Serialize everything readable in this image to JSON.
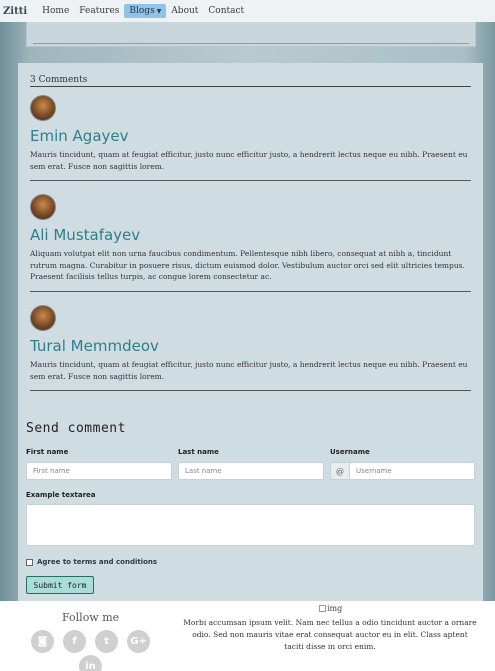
{
  "navbar": {
    "brand": "Zitti",
    "links": [
      "Home",
      "Features",
      "Blogs",
      "About",
      "Contact"
    ],
    "active": "Blogs"
  },
  "comments": {
    "count_label": "3 Comments",
    "items": [
      {
        "name": "Emin Agayev",
        "text": "Mauris tincidunt, quam at feugiat efficitur, justo nunc efficitur justo, a hendrerit lectus neque eu nibh. Praesent eu sem erat. Fusce non sagittis lorem."
      },
      {
        "name": "Ali Mustafayev",
        "text": "Aliquam volutpat elit non urna faucibus condimentum. Pellentesque nibh libero, consequat at nibh a, tincidunt rutrum magna. Curabitur in posuere risus, dictum euismod dolor. Vestibulum auctor orci sed elit ultricies tempus. Praesent facilisis tellus turpis, ac congue lorem consectetur ac."
      },
      {
        "name": "Tural Memmdeov",
        "text": "Mauris tincidunt, quam at feugiat efficitur, justo nunc efficitur justo, a hendrerit lectus neque eu nibh. Praesent eu sem erat. Fusce non sagittis lorem."
      }
    ]
  },
  "form": {
    "title": "Send comment",
    "first_name_label": "First name",
    "first_name_placeholder": "First name",
    "last_name_label": "Last name",
    "last_name_placeholder": "Last name",
    "username_label": "Username",
    "username_prefix": "@",
    "username_placeholder": "Username",
    "textarea_label": "Example textarea",
    "terms_label": "Agree to terms and conditions",
    "submit_label": "Submit form"
  },
  "footer": {
    "follow_label": "Follow me",
    "social_icons": [
      "instagram-icon",
      "facebook-icon",
      "twitter-icon",
      "google-plus-icon",
      "linkedin-icon"
    ],
    "social_glyphs": [
      "◙",
      "f",
      "t",
      "G+",
      "in"
    ],
    "image_alt": "img",
    "text": "Morbi accumsan ipsum velit. Nam nec tellus a odio tincidunt auctor a ornare odio. Sed non mauris vitae erat consequat auctor eu in elit. Class aptent taciti disse in orci enim."
  },
  "colors": {
    "accent": "#2f7f8a",
    "nav_active": "#8fc3e8",
    "submit_bg": "#a9ddd8"
  }
}
